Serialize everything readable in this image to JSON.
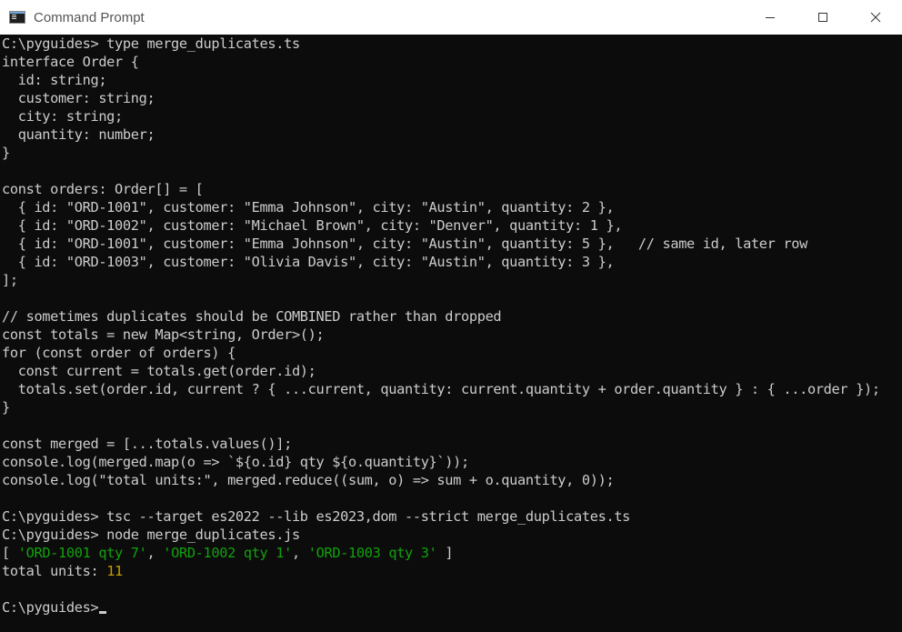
{
  "window": {
    "title": "Command Prompt",
    "controls": [
      "minimize",
      "maximize",
      "close"
    ]
  },
  "terminal": {
    "lines": [
      "C:\\pyguides> type merge_duplicates.ts",
      "interface Order {",
      "  id: string;",
      "  customer: string;",
      "  city: string;",
      "  quantity: number;",
      "}",
      "",
      "const orders: Order[] = [",
      "  { id: \"ORD-1001\", customer: \"Emma Johnson\", city: \"Austin\", quantity: 2 },",
      "  { id: \"ORD-1002\", customer: \"Michael Brown\", city: \"Denver\", quantity: 1 },",
      "  { id: \"ORD-1001\", customer: \"Emma Johnson\", city: \"Austin\", quantity: 5 },   // same id, later row",
      "  { id: \"ORD-1003\", customer: \"Olivia Davis\", city: \"Austin\", quantity: 3 },",
      "];",
      "",
      "// sometimes duplicates should be COMBINED rather than dropped",
      "const totals = new Map<string, Order>();",
      "for (const order of orders) {",
      "  const current = totals.get(order.id);",
      "  totals.set(order.id, current ? { ...current, quantity: current.quantity + order.quantity } : { ...order });",
      "}",
      "",
      "const merged = [...totals.values()];",
      "console.log(merged.map(o => `${o.id} qty ${o.quantity}`));",
      "console.log(\"total units:\", merged.reduce((sum, o) => sum + o.quantity, 0));",
      "",
      "C:\\pyguides> tsc --target es2022 --lib es2023,dom --strict merge_duplicates.ts",
      "C:\\pyguides> node merge_duplicates.js"
    ],
    "output_array": {
      "open": "[ ",
      "items": [
        "'ORD-1001 qty 7'",
        "'ORD-1002 qty 1'",
        "'ORD-1003 qty 3'"
      ],
      "sep": ", ",
      "close": " ]"
    },
    "total_line": {
      "label": "total units: ",
      "value": "11"
    },
    "prompt": "C:\\pyguides>",
    "colors": {
      "background": "#0c0c0c",
      "text": "#cccccc",
      "string": "#13a10e",
      "number": "#c19c00"
    }
  }
}
